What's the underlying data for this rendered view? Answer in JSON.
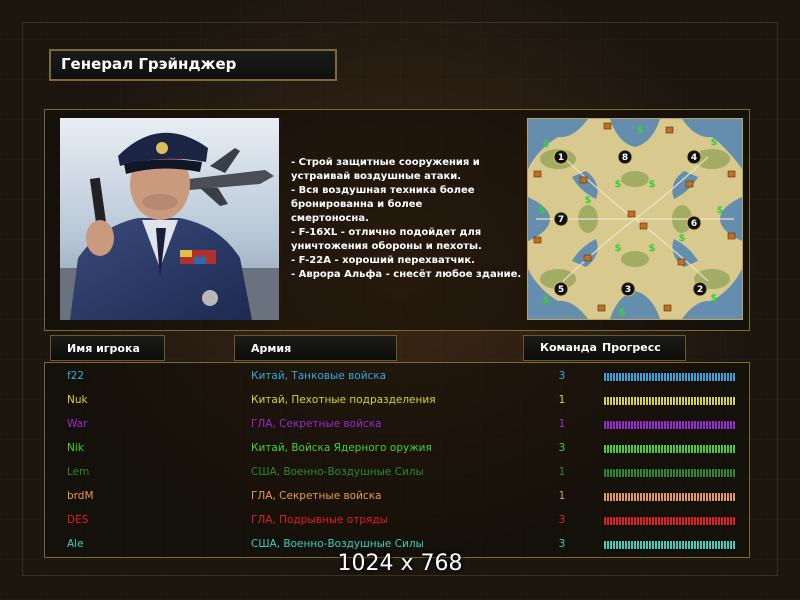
{
  "general": {
    "name": "Генерал Грэйнджер",
    "briefing": "- Строй защитные сооружения и\n устраивай воздушные атаки.\n- Вся воздушная техника более\n бронированна и более\nсмертоносна.\n- F-16XL - отлично подойдет для\n уничтожения обороны и пехоты.\n- F-22A - хороший перехватчик.\n- Аврора Альфа - снесёт любое здание."
  },
  "columns": {
    "player": "Имя игрока",
    "army": "Армия",
    "team": "Команда",
    "progress": "Прогресс"
  },
  "players": [
    {
      "name": "f22",
      "army": "Китай, Танковые войска",
      "team": "3",
      "color": "#33a8e0",
      "progress": 1.0
    },
    {
      "name": "Nuk",
      "army": "Китай, Пехотные подразделения",
      "team": "1",
      "color": "#d6d43a",
      "progress": 1.0
    },
    {
      "name": "War",
      "army": "ГЛА, Секретные войска",
      "team": "1",
      "color": "#9a2ad0",
      "progress": 1.0
    },
    {
      "name": "Nik",
      "army": "Китай, Войска Ядерного оружия",
      "team": "3",
      "color": "#4ad02c",
      "progress": 1.0
    },
    {
      "name": "Lem",
      "army": "США, Военно-Воздушные Силы",
      "team": "1",
      "color": "#2d8a28",
      "progress": 1.0
    },
    {
      "name": "brdM",
      "army": "ГЛА, Секретные войска",
      "team": "1",
      "color": "#e89a4e",
      "progress": 1.0
    },
    {
      "name": "DES",
      "army": "ГЛА, Подрывные отряды",
      "team": "3",
      "color": "#e02020",
      "progress": 1.0
    },
    {
      "name": "Ale",
      "army": "США, Военно-Воздушные Силы",
      "team": "3",
      "color": "#3ad0c0",
      "progress": 1.0
    }
  ],
  "map": {
    "start_positions": [
      "1",
      "2",
      "3",
      "4",
      "5",
      "6",
      "7",
      "8"
    ]
  },
  "resolution_label": "1024 x 768",
  "colors": {
    "panel_border": "#7a6a3a",
    "header_border": "#6a5a2a",
    "background": "#1c160f"
  },
  "icons": {
    "supply": "dollar-sign-icon",
    "oil_derrick": "oil-derrick-icon"
  }
}
